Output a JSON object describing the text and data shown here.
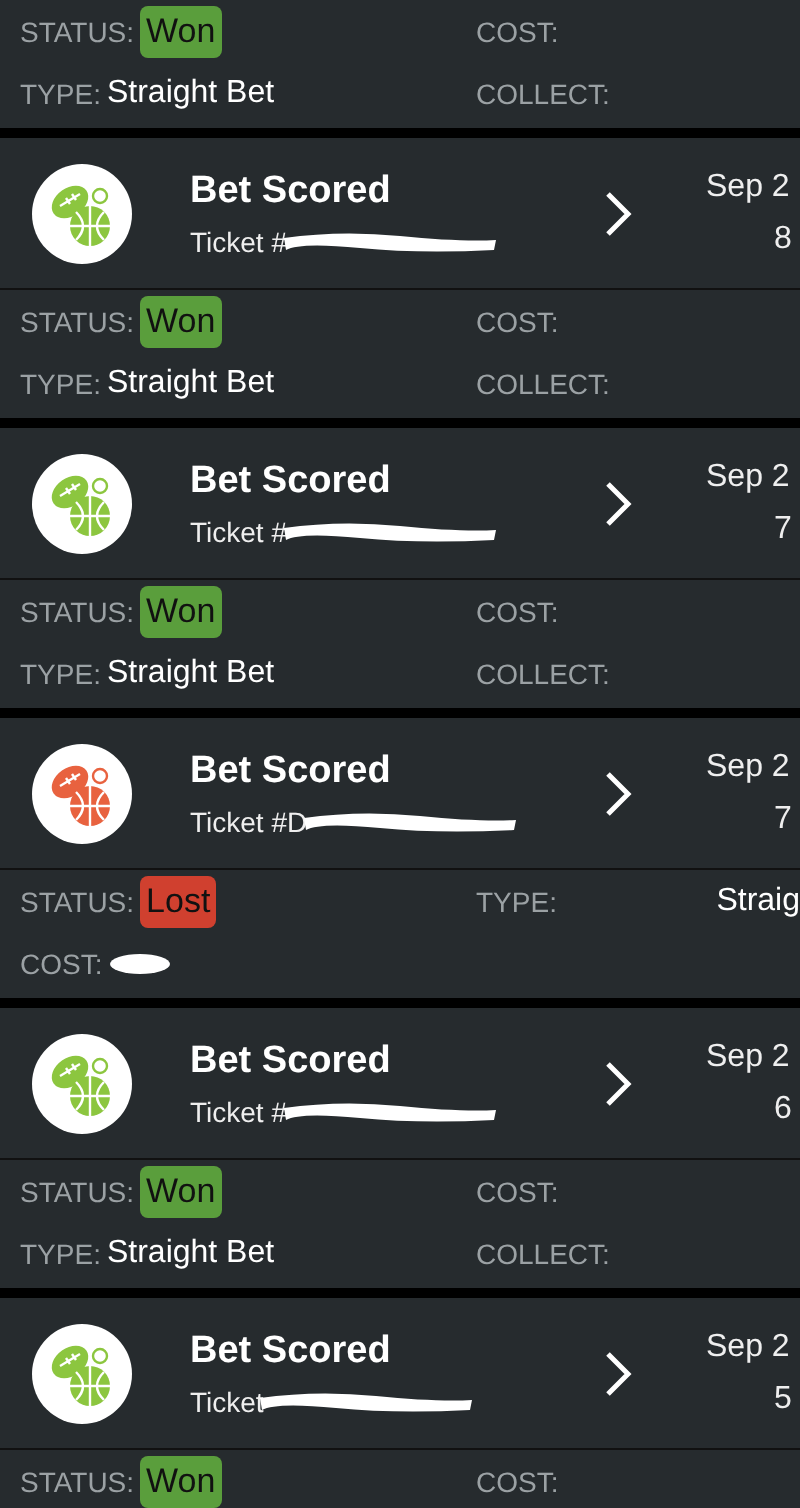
{
  "top_details": {
    "fields": [
      {
        "label": "STATUS:",
        "kind": "badge",
        "value": "Won",
        "color": "#5a9e3c"
      },
      {
        "label": "COST:",
        "kind": "empty"
      },
      {
        "label": "TYPE:",
        "kind": "text",
        "value": "Straight Bet"
      },
      {
        "label": "COLLECT:",
        "kind": "empty"
      }
    ]
  },
  "tickets": [
    {
      "title": "Bet Scored",
      "ticket": "Ticket #",
      "color": "#8cc63f",
      "date": "Sep 2",
      "time": "8",
      "fields": [
        {
          "label": "STATUS:",
          "kind": "badge",
          "value": "Won",
          "color": "#5a9e3c"
        },
        {
          "label": "COST:",
          "kind": "empty"
        },
        {
          "label": "TYPE:",
          "kind": "text",
          "value": "Straight Bet"
        },
        {
          "label": "COLLECT:",
          "kind": "empty"
        }
      ]
    },
    {
      "title": "Bet Scored",
      "ticket": "Ticket #",
      "color": "#8cc63f",
      "date": "Sep 2",
      "time": "7",
      "fields": [
        {
          "label": "STATUS:",
          "kind": "badge",
          "value": "Won",
          "color": "#5a9e3c"
        },
        {
          "label": "COST:",
          "kind": "empty"
        },
        {
          "label": "TYPE:",
          "kind": "text",
          "value": "Straight Bet"
        },
        {
          "label": "COLLECT:",
          "kind": "empty"
        }
      ]
    },
    {
      "title": "Bet Scored",
      "ticket": "Ticket #D",
      "color": "#e8623f",
      "date": "Sep 2",
      "time": "7",
      "fields": [
        {
          "label": "STATUS:",
          "kind": "badge",
          "value": "Lost",
          "color": "#d0402f"
        },
        {
          "label": "TYPE:",
          "kind": "far",
          "value": "Straig"
        },
        {
          "label": "COST:",
          "kind": "redacted"
        }
      ]
    },
    {
      "title": "Bet Scored",
      "ticket": "Ticket #",
      "color": "#8cc63f",
      "date": "Sep 2",
      "time": "6",
      "fields": [
        {
          "label": "STATUS:",
          "kind": "badge",
          "value": "Won",
          "color": "#5a9e3c"
        },
        {
          "label": "COST:",
          "kind": "empty"
        },
        {
          "label": "TYPE:",
          "kind": "text",
          "value": "Straight Bet"
        },
        {
          "label": "COLLECT:",
          "kind": "empty"
        }
      ]
    },
    {
      "title": "Bet Scored",
      "ticket": "Ticket",
      "color": "#8cc63f",
      "date": "Sep 2",
      "time": "5",
      "fields": [
        {
          "label": "STATUS:",
          "kind": "badge",
          "value": "Won",
          "color": "#5a9e3c"
        },
        {
          "label": "COST:",
          "kind": "empty"
        }
      ]
    }
  ]
}
